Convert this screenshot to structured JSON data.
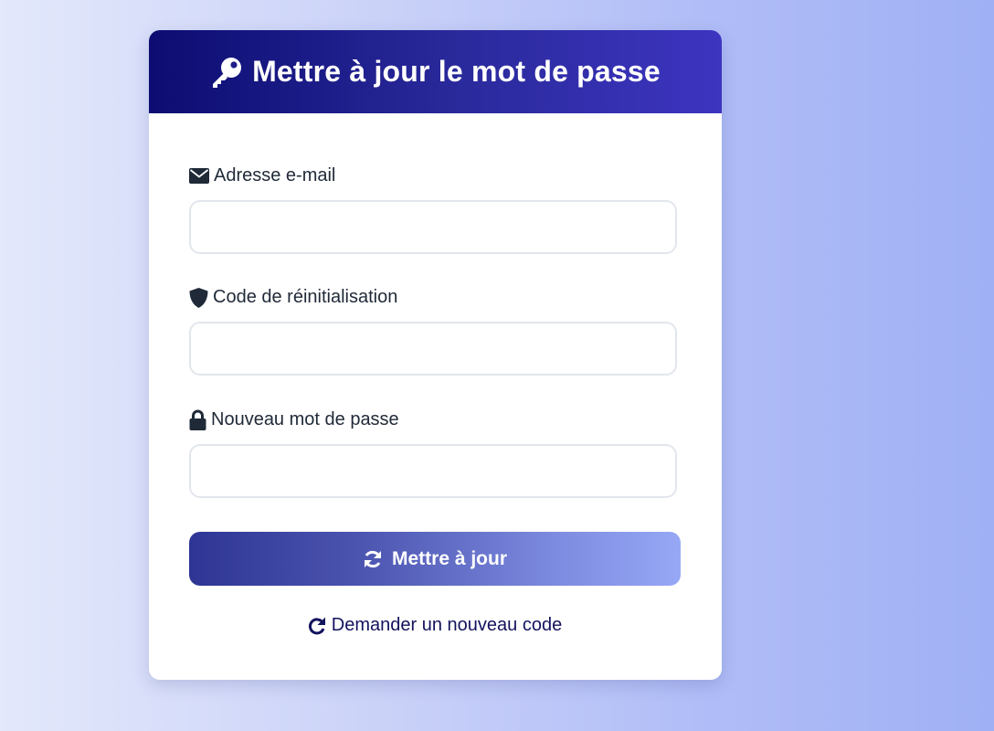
{
  "header": {
    "title": "Mettre à jour le mot de passe",
    "icon": "key-icon"
  },
  "form": {
    "email": {
      "label": "Adresse e-mail",
      "icon": "envelope-icon",
      "value": "",
      "placeholder": ""
    },
    "reset_code": {
      "label": "Code de réinitialisation",
      "icon": "shield-icon",
      "value": "",
      "placeholder": ""
    },
    "new_password": {
      "label": "Nouveau mot de passe",
      "icon": "lock-icon",
      "value": "",
      "placeholder": ""
    },
    "submit": {
      "label": "Mettre à jour",
      "icon": "sync-icon"
    },
    "resend": {
      "label": "Demander un nouveau code",
      "icon": "redo-icon"
    }
  },
  "colors": {
    "header_start": "#0c0c72",
    "header_end": "#3d34c0",
    "button_start": "#2e3594",
    "button_end": "#97a8f6",
    "link": "#13135e",
    "label_text": "#1f2937"
  }
}
